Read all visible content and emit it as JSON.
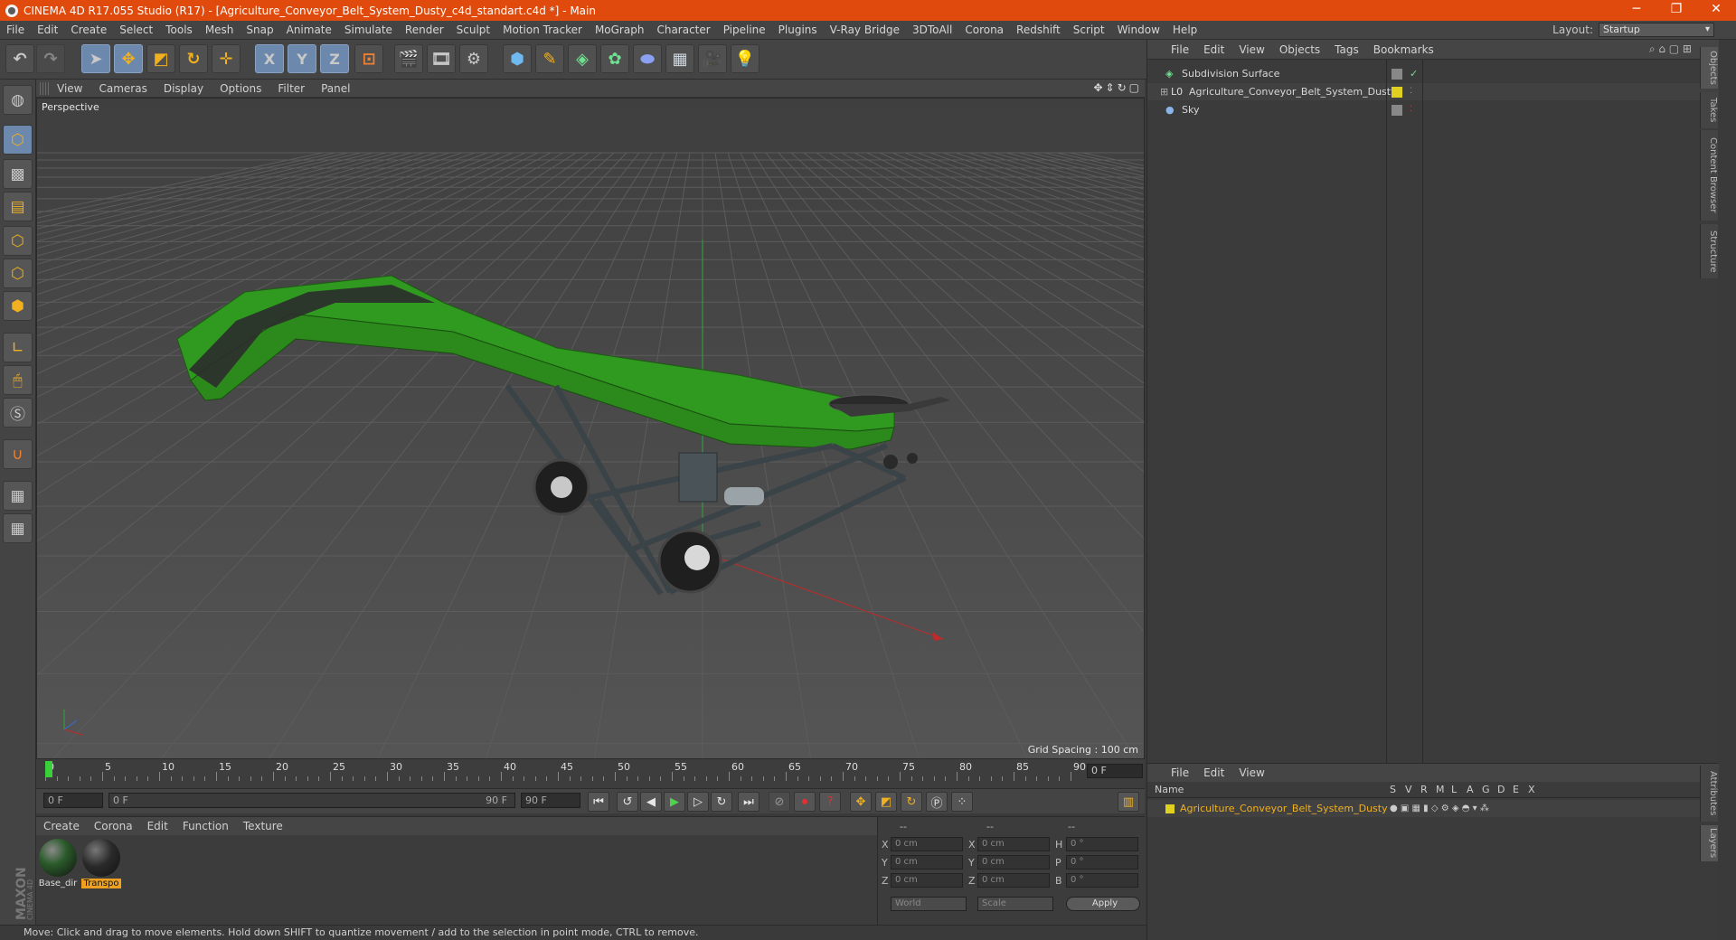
{
  "titlebar": {
    "text": "CINEMA 4D R17.055 Studio (R17) - [Agriculture_Conveyor_Belt_System_Dusty_c4d_standart.c4d *] - Main",
    "minimize": "─",
    "restore": "❐",
    "close": "✕"
  },
  "menu": [
    "File",
    "Edit",
    "Create",
    "Select",
    "Tools",
    "Mesh",
    "Snap",
    "Animate",
    "Simulate",
    "Render",
    "Sculpt",
    "Motion Tracker",
    "MoGraph",
    "Character",
    "Pipeline",
    "Plugins",
    "V-Ray Bridge",
    "3DToAll",
    "Corona",
    "Redshift",
    "Script",
    "Window",
    "Help"
  ],
  "layout": {
    "label": "Layout:",
    "value": "Startup"
  },
  "toolbar": {
    "axis_x": "X",
    "axis_y": "Y",
    "axis_z": "Z"
  },
  "viewport": {
    "menu": [
      "View",
      "Cameras",
      "Display",
      "Options",
      "Filter",
      "Panel"
    ],
    "label": "Perspective",
    "grid_spacing": "Grid Spacing : 100 cm"
  },
  "timeline": {
    "ticks": [
      "0",
      "5",
      "10",
      "15",
      "20",
      "25",
      "30",
      "35",
      "40",
      "45",
      "50",
      "55",
      "60",
      "65",
      "70",
      "75",
      "80",
      "85",
      "90"
    ],
    "frame_field": "0 F",
    "start_field": "0 F",
    "range_start": "0 F",
    "range_end": "90 F",
    "end_field": "90 F"
  },
  "materials": {
    "menu": [
      "Create",
      "Corona",
      "Edit",
      "Function",
      "Texture"
    ],
    "items": [
      {
        "label": "Base_dir",
        "selected": false
      },
      {
        "label": "Transpo",
        "selected": true
      }
    ]
  },
  "coords": {
    "headers": [
      "--",
      "--",
      "--"
    ],
    "rows": [
      {
        "a": "X",
        "av": "0 cm",
        "b": "X",
        "bv": "0 cm",
        "c": "H",
        "cv": "0 °"
      },
      {
        "a": "Y",
        "av": "0 cm",
        "b": "Y",
        "bv": "0 cm",
        "c": "P",
        "cv": "0 °"
      },
      {
        "a": "Z",
        "av": "0 cm",
        "b": "Z",
        "bv": "0 cm",
        "c": "B",
        "cv": "0 °"
      }
    ],
    "world": "World",
    "scale": "Scale",
    "apply": "Apply"
  },
  "status": "Move: Click and drag to move elements. Hold down SHIFT to quantize movement / add to the selection in point mode, CTRL to remove.",
  "objects": {
    "menu": [
      "File",
      "Edit",
      "View",
      "Objects",
      "Tags",
      "Bookmarks"
    ],
    "rows": [
      {
        "name": "Subdivision Surface",
        "indent": 0
      },
      {
        "name": "Agriculture_Conveyor_Belt_System_Dusty",
        "indent": 1
      },
      {
        "name": "Sky",
        "indent": 0
      }
    ],
    "side_tabs": [
      "Objects",
      "Takes",
      "Content Browser",
      "Structure"
    ]
  },
  "layers": {
    "menu": [
      "File",
      "Edit",
      "View"
    ],
    "col_name": "Name",
    "cols": [
      "S",
      "V",
      "R",
      "M",
      "L",
      "A",
      "G",
      "D",
      "E",
      "X"
    ],
    "row": "Agriculture_Conveyor_Belt_System_Dusty",
    "side_tabs": [
      "Attributes",
      "Layers"
    ]
  },
  "colors": {
    "accent": "#e04a0c",
    "highlight": "#f0b020",
    "active": "#6c88ad"
  },
  "logo": "MAXON CINEMA 4D"
}
